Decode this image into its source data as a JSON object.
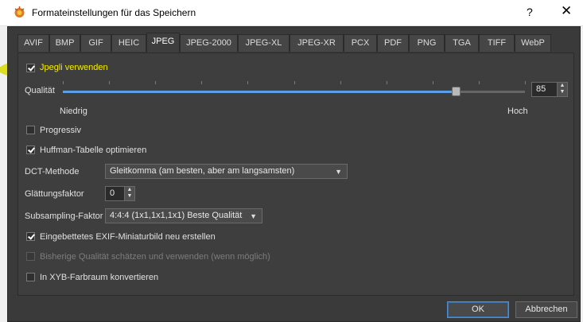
{
  "window": {
    "title": "Formateinstellungen für das Speichern",
    "help_label": "?",
    "close_label": "✕"
  },
  "tabs": [
    "AVIF",
    "BMP",
    "GIF",
    "HEIC",
    "JPEG",
    "JPEG-2000",
    "JPEG-XL",
    "JPEG-XR",
    "PCX",
    "PDF",
    "PNG",
    "TGA",
    "TIFF",
    "WebP"
  ],
  "active_tab": "JPEG",
  "jpegli": {
    "label": "Jpegli verwenden",
    "checked": true
  },
  "quality": {
    "label": "Qualität",
    "value": "85",
    "value_fraction": 0.85,
    "min_label": "Niedrig",
    "max_label": "Hoch"
  },
  "progressive": {
    "label": "Progressiv",
    "checked": false
  },
  "huffman": {
    "label": "Huffman-Tabelle optimieren",
    "checked": true
  },
  "dct": {
    "label": "DCT-Methode",
    "selected": "Gleitkomma (am besten, aber am langsamsten)"
  },
  "smoothing": {
    "label": "Glättungsfaktor",
    "value": "0"
  },
  "subsampling": {
    "label": "Subsampling-Faktor",
    "selected": "4:4:4 (1x1,1x1,1x1) Beste Qualität"
  },
  "exif_thumb": {
    "label": "Eingebettetes EXIF-Miniaturbild neu erstellen",
    "checked": true
  },
  "estimate_quality": {
    "label": "Bisherige Qualität schätzen und verwenden (wenn möglich)",
    "checked": false,
    "disabled": true
  },
  "xyb": {
    "label": "In XYB-Farbraum konvertieren",
    "checked": false
  },
  "buttons": {
    "ok": "OK",
    "cancel": "Abbrechen"
  },
  "colors": {
    "highlight": "#d9db00",
    "accent": "#5a9ee6",
    "panel": "#3e3e3e"
  }
}
